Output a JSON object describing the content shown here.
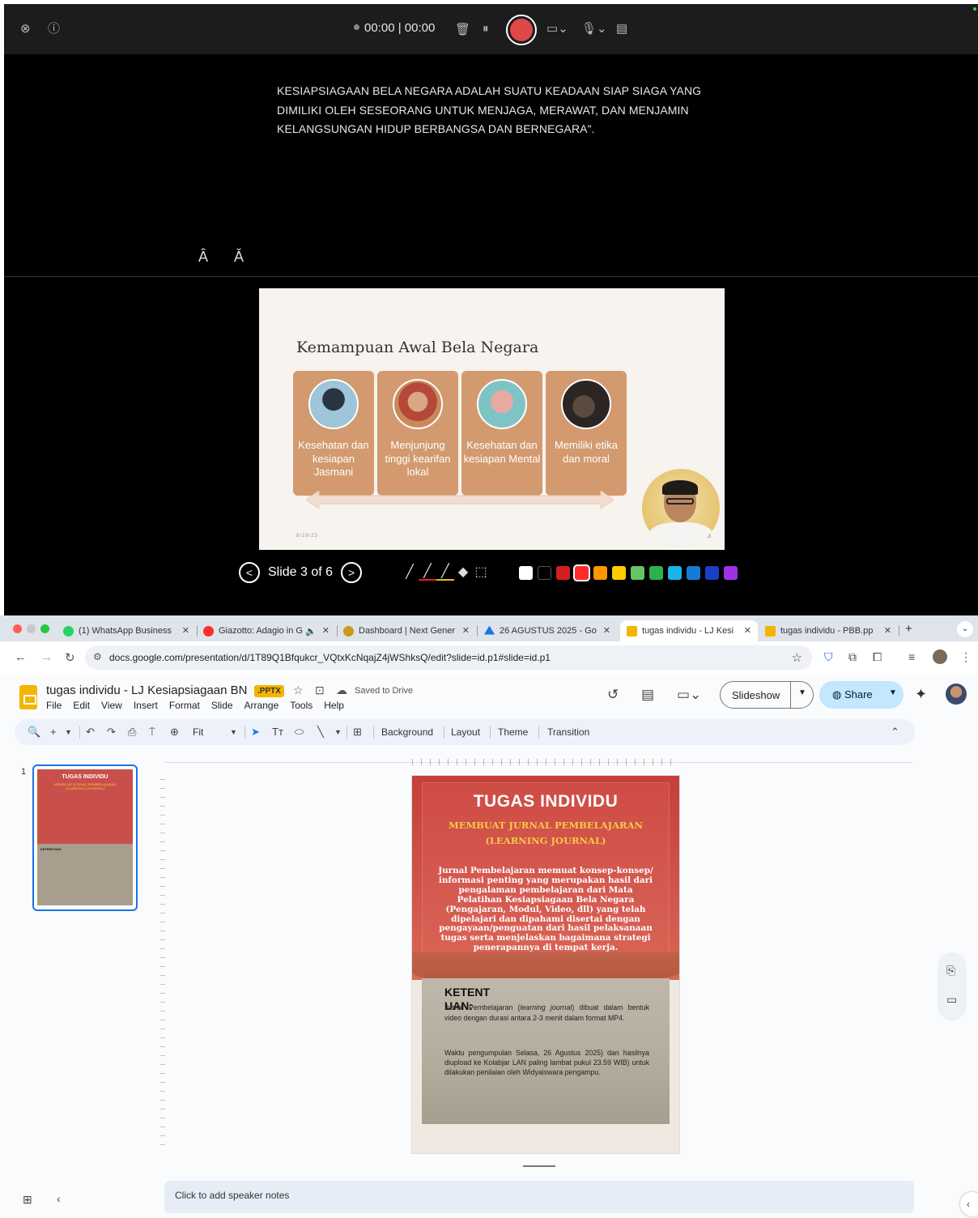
{
  "recorder": {
    "timer": "00:00 | 00:00",
    "caption": "KESIAPSIAGAAN BELA NEGARA ADALAH SUATU KEADAAN  SIAP SIAGA YANG DIMILIKI OLEH SESEORANG UNTUK MENJAGA, MERAWAT, DAN MENJAMIN KELANGSUNGAN HIDUP BERBANGSA DAN BERNEGARA\".",
    "font_increase": "Â",
    "font_decrease": "Ǎ",
    "icons": [
      "close-icon",
      "info-icon",
      "trash-icon",
      "pause-icon",
      "record-button",
      "camera-icon",
      "microphone-icon",
      "layout-icon"
    ]
  },
  "presentation": {
    "title": "Kemampuan Awal Bela Negara",
    "cards": [
      {
        "label": "Kesehatan dan kesiapan Jasmani",
        "color": "#9ec5d8"
      },
      {
        "label": "Menjunjung tinggi kearifan lokal",
        "color": "#c98a5a"
      },
      {
        "label": "Kesehatan dan kesiapan Mental",
        "color": "#7fc4c4"
      },
      {
        "label": "Memiliki etika dan moral",
        "color": "#2b2623"
      }
    ],
    "date": "8/28/23",
    "page_number": "3",
    "slide_counter": "Slide 3 of 6",
    "swatches": [
      "#ffffff",
      "#000000",
      "#d21f1f",
      "#ff2a2a",
      "#ff9500",
      "#ffcc00",
      "#65c466",
      "#2bb24c",
      "#1ab4e6",
      "#1579d8",
      "#1a3fc0",
      "#a032e6"
    ]
  },
  "browser": {
    "tabs": [
      {
        "title": "(1) WhatsApp Business",
        "favicon": "#25d366"
      },
      {
        "title": "Giazotto: Adagio in G",
        "favicon": "#ff2d2d"
      },
      {
        "title": "Dashboard | Next Gener",
        "favicon": "#c89a1c"
      },
      {
        "title": "26 AGUSTUS 2025 - Go",
        "favicon": "#1a73e8"
      },
      {
        "title": "tugas individu - LJ Kesi",
        "favicon": "#f4b400"
      },
      {
        "title": "tugas individu - PBB.pp",
        "favicon": "#f4b400"
      }
    ],
    "url": "docs.google.com/presentation/d/1T89Q1Bfqukcr_VQtxKcNqajZ4jWShksQ/edit?slide=id.p1#slide=id.p1"
  },
  "app": {
    "doc_title": "tugas individu - LJ Kesiapsiagaan BN",
    "badge": ".PPTX",
    "saved_status": "Saved to Drive",
    "menu": [
      "File",
      "Edit",
      "View",
      "Insert",
      "Format",
      "Slide",
      "Arrange",
      "Tools",
      "Help"
    ],
    "slideshow_label": "Slideshow",
    "share_label": "Share",
    "zoom_label": "Fit",
    "toolbar_text": [
      "Background",
      "Layout",
      "Theme",
      "Transition"
    ],
    "filmstrip_number": "1",
    "notes_placeholder": "Click to add speaker notes"
  },
  "slide": {
    "title": "TUGAS INDIVIDU",
    "subtitle_line1": "MEMBUAT JURNAL PEMBELAJARAN",
    "subtitle_line2": "(LEARNING JOURNAL)",
    "body": "Jurnal Pembelajaran memuat konsep-konsep/ informasi penting yang merupakan hasil dari pengalaman pembelajaran dari Mata Pelatihan Kesiapsiagaan Bela Negara (Pengajaran, Modul, Video, dll) yang telah dipelajari dan dipahami disertai  dengan pengayaan/penguatan dari hasil pelaksanaan  tugas serta menjelaskan bagaimana strategi  penerapannya di tempat kerja.",
    "ketentuan": "KETENTUAN:",
    "para1_prefix": "Jurnal Pembelajaran (",
    "para1_italic": "learning journal",
    "para1_suffix": ") dibuat dalam bentuk video dengan durasi antara 2-3 menit  dalam format MP4.",
    "para2": "Waktu pengumpulan Selasa, 26 Agustus 2025) dan hasilnya diupload ke Kolabjar  LAN  paling lambat pukul 23.59 WIB) untuk dilakukan penilaian  oleh Widyaiswara pengampu."
  }
}
